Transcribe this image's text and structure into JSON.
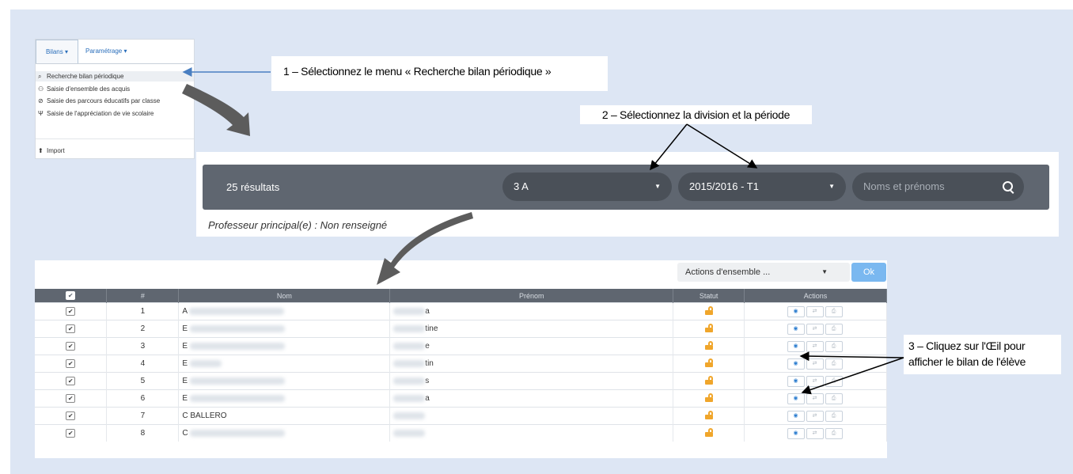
{
  "menu": {
    "tabs": [
      {
        "label": "Bilans"
      },
      {
        "label": "Paramétrage"
      }
    ],
    "items": [
      {
        "icon": "search-icon",
        "glyph": "🔍",
        "label": "Recherche bilan périodique"
      },
      {
        "icon": "users-icon",
        "glyph": "👥",
        "label": "Saisie d'ensemble des acquis"
      },
      {
        "icon": "compass-icon",
        "glyph": "⊘",
        "label": "Saisie des parcours éducatifs par classe"
      },
      {
        "icon": "fork-icon",
        "glyph": "Ψ",
        "label": "Saisie de l'appréciation de vie scolaire"
      },
      {
        "icon": "upload-icon",
        "glyph": "⇧",
        "label": "Import"
      }
    ]
  },
  "callouts": {
    "step1": "1 – Sélectionnez le menu « Recherche bilan périodique »",
    "step2": "2 – Sélectionnez la division et la période",
    "step3": "3 – Cliquez sur l'Œil pour afficher le bilan de l'élève"
  },
  "filter": {
    "result_count": "25 résultats",
    "division": "3 A",
    "periode": "2015/2016 - T1",
    "search_placeholder": "Noms et prénoms",
    "prof_principal": "Professeur principal(e) : Non renseigné"
  },
  "bulk": {
    "select_label": "Actions d'ensemble ...",
    "ok_label": "Ok"
  },
  "table": {
    "headers": {
      "num": "#",
      "nom": "Nom",
      "prenom": "Prénom",
      "statut": "Statut",
      "actions": "Actions"
    },
    "rows": [
      {
        "num": "1",
        "nom_visible": "A",
        "prenom_visible": "a"
      },
      {
        "num": "2",
        "nom_visible": "E",
        "prenom_visible": "tine"
      },
      {
        "num": "3",
        "nom_visible": "E",
        "prenom_visible": "e"
      },
      {
        "num": "4",
        "nom_visible": "E",
        "prenom_visible": "tin"
      },
      {
        "num": "5",
        "nom_visible": "E",
        "prenom_visible": "s"
      },
      {
        "num": "6",
        "nom_visible": "E",
        "prenom_visible": "a"
      },
      {
        "num": "7",
        "nom_visible": "C BALLERO",
        "prenom_visible": ""
      },
      {
        "num": "8",
        "nom_visible": "C",
        "prenom_visible": ""
      }
    ]
  },
  "colors": {
    "page_bg": "#dde6f4",
    "bar_bg": "#5f6670",
    "pill_bg": "#4a5058",
    "lock": "#f0a62b",
    "ok": "#7ab8f0",
    "link": "#2a6ebb"
  }
}
